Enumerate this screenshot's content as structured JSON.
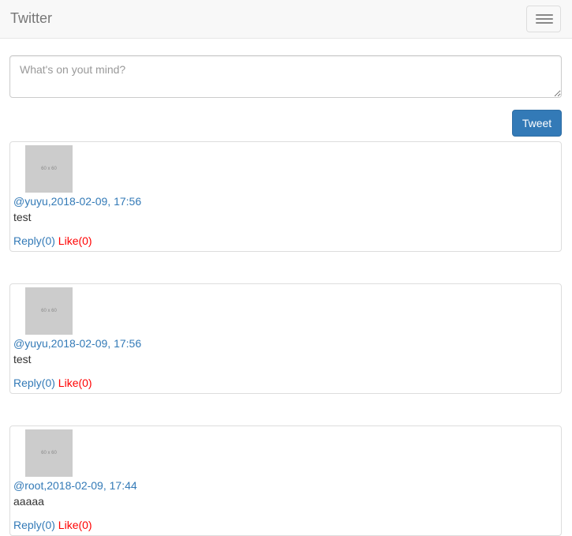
{
  "navbar": {
    "brand": "Twitter",
    "menu_icon": "hamburger-menu-icon"
  },
  "compose": {
    "placeholder": "What's on yout mind?",
    "value": "",
    "button_label": "Tweet"
  },
  "tweets": [
    {
      "avatar_label": "60 x 60",
      "meta": "@yuyu,2018-02-09, 17:56",
      "text": "test",
      "reply_label": "Reply(0)",
      "like_label": "Like(0)"
    },
    {
      "avatar_label": "60 x 60",
      "meta": "@yuyu,2018-02-09, 17:56",
      "text": "test",
      "reply_label": "Reply(0)",
      "like_label": "Like(0)"
    },
    {
      "avatar_label": "60 x 60",
      "meta": "@root,2018-02-09, 17:44",
      "text": "aaaaa",
      "reply_label": "Reply(0)",
      "like_label": "Like(0)"
    }
  ],
  "colors": {
    "navbar_bg": "#f8f8f8",
    "brand_text": "#777777",
    "primary": "#337ab7",
    "like": "#ff0000",
    "card_border": "#dddddd"
  }
}
